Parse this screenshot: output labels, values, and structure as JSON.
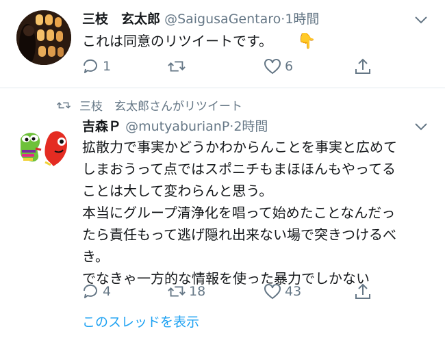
{
  "tweet1": {
    "display_name": "三枝　玄太郎",
    "handle": "@SaigusaGentaro",
    "separator": "·",
    "time": "1時間",
    "text": "これは同意のリツイートです。",
    "emoji": "👇",
    "reply_count": "1",
    "retweet_count": "",
    "like_count": "6"
  },
  "tweet2": {
    "retweet_context": "三枝　玄太郎さんがリツイート",
    "display_name": "吉森Ｐ",
    "handle": "@mutyaburianP",
    "separator": "·",
    "time": "2時間",
    "text_lines": [
      "拡散力で事実かどうかわからんことを事実と広めて",
      "しまおうって点ではスポニチもまほほんもやってる",
      "ことは大して変わらんと思う。",
      "本当にグループ清浄化を唱って始めたことなんだっ",
      "たら責任もって逃げ隠れ出来ない場で突きつけるべ",
      "き。",
      "でなきゃ一方的な情報を使った暴力でしかない"
    ],
    "reply_count": "4",
    "retweet_count": "18",
    "like_count": "43",
    "thread_link": "このスレッドを表示"
  },
  "colors": {
    "accent": "#1da1f2",
    "secondary_text": "#657786",
    "divider": "#e1e8ed"
  },
  "icons": [
    "chevron-down-icon",
    "reply-icon",
    "retweet-icon",
    "like-icon",
    "share-icon"
  ]
}
